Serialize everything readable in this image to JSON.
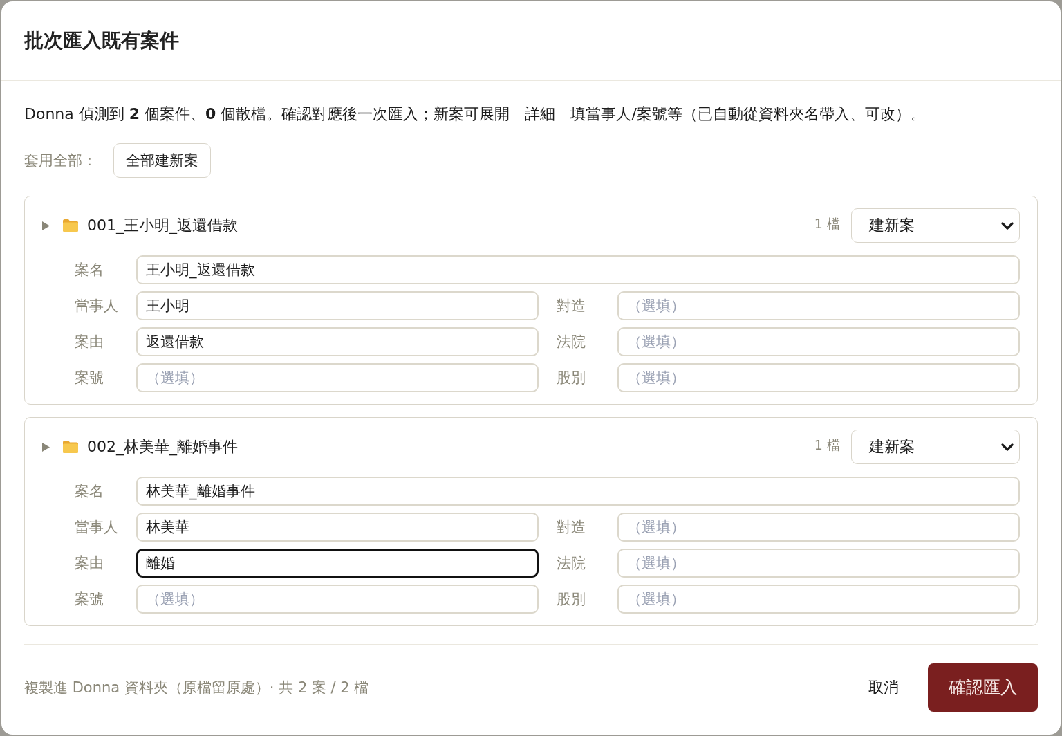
{
  "dialog": {
    "title": "批次匯入既有案件"
  },
  "description": "Donna 偵測到 **2** 個案件、**0** 個散檔。確認對應後一次匯入；新案可展開「詳細」填當事人/案號等（已自動從資料夾名帶入、可改）。",
  "apply_all": {
    "label": "套用全部：",
    "button": "全部建新案"
  },
  "cases": [
    {
      "folder": "001_王小明_返還借款",
      "file_count": "1 檔",
      "action": "建新案",
      "fields": [
        {
          "kind": "wide",
          "label": "案名",
          "value": "王小明_返還借款",
          "focused": false
        },
        {
          "kind": "half",
          "label": "當事人",
          "value": "王小明",
          "focused": false
        },
        {
          "kind": "half",
          "label": "對造",
          "placeholder": "（選填）",
          "focused": false
        },
        {
          "kind": "half",
          "label": "案由",
          "value": "返還借款",
          "focused": false
        },
        {
          "kind": "half",
          "label": "法院",
          "placeholder": "（選填）",
          "focused": false
        },
        {
          "kind": "half",
          "label": "案號",
          "placeholder": "（選填）",
          "focused": false
        },
        {
          "kind": "half",
          "label": "股別",
          "placeholder": "（選填）",
          "focused": false
        }
      ]
    },
    {
      "folder": "002_林美華_離婚事件",
      "file_count": "1 檔",
      "action": "建新案",
      "fields": [
        {
          "kind": "wide",
          "label": "案名",
          "value": "林美華_離婚事件",
          "focused": false
        },
        {
          "kind": "half",
          "label": "當事人",
          "value": "林美華",
          "focused": false
        },
        {
          "kind": "half",
          "label": "對造",
          "placeholder": "（選填）",
          "focused": false
        },
        {
          "kind": "half",
          "label": "案由",
          "value": "離婚",
          "focused": true
        },
        {
          "kind": "half",
          "label": "法院",
          "placeholder": "（選填）",
          "focused": false
        },
        {
          "kind": "half",
          "label": "案號",
          "placeholder": "（選填）",
          "focused": false
        },
        {
          "kind": "half",
          "label": "股別",
          "placeholder": "（選填）",
          "focused": false
        }
      ]
    }
  ],
  "footer": {
    "summary": "複製進 Donna 資料夾（原檔留原處）· 共 2 案 / 2 檔",
    "buttons": [
      {
        "kind": "plain",
        "label": "取消"
      },
      {
        "kind": "primary",
        "label": "確認匯入"
      }
    ]
  }
}
